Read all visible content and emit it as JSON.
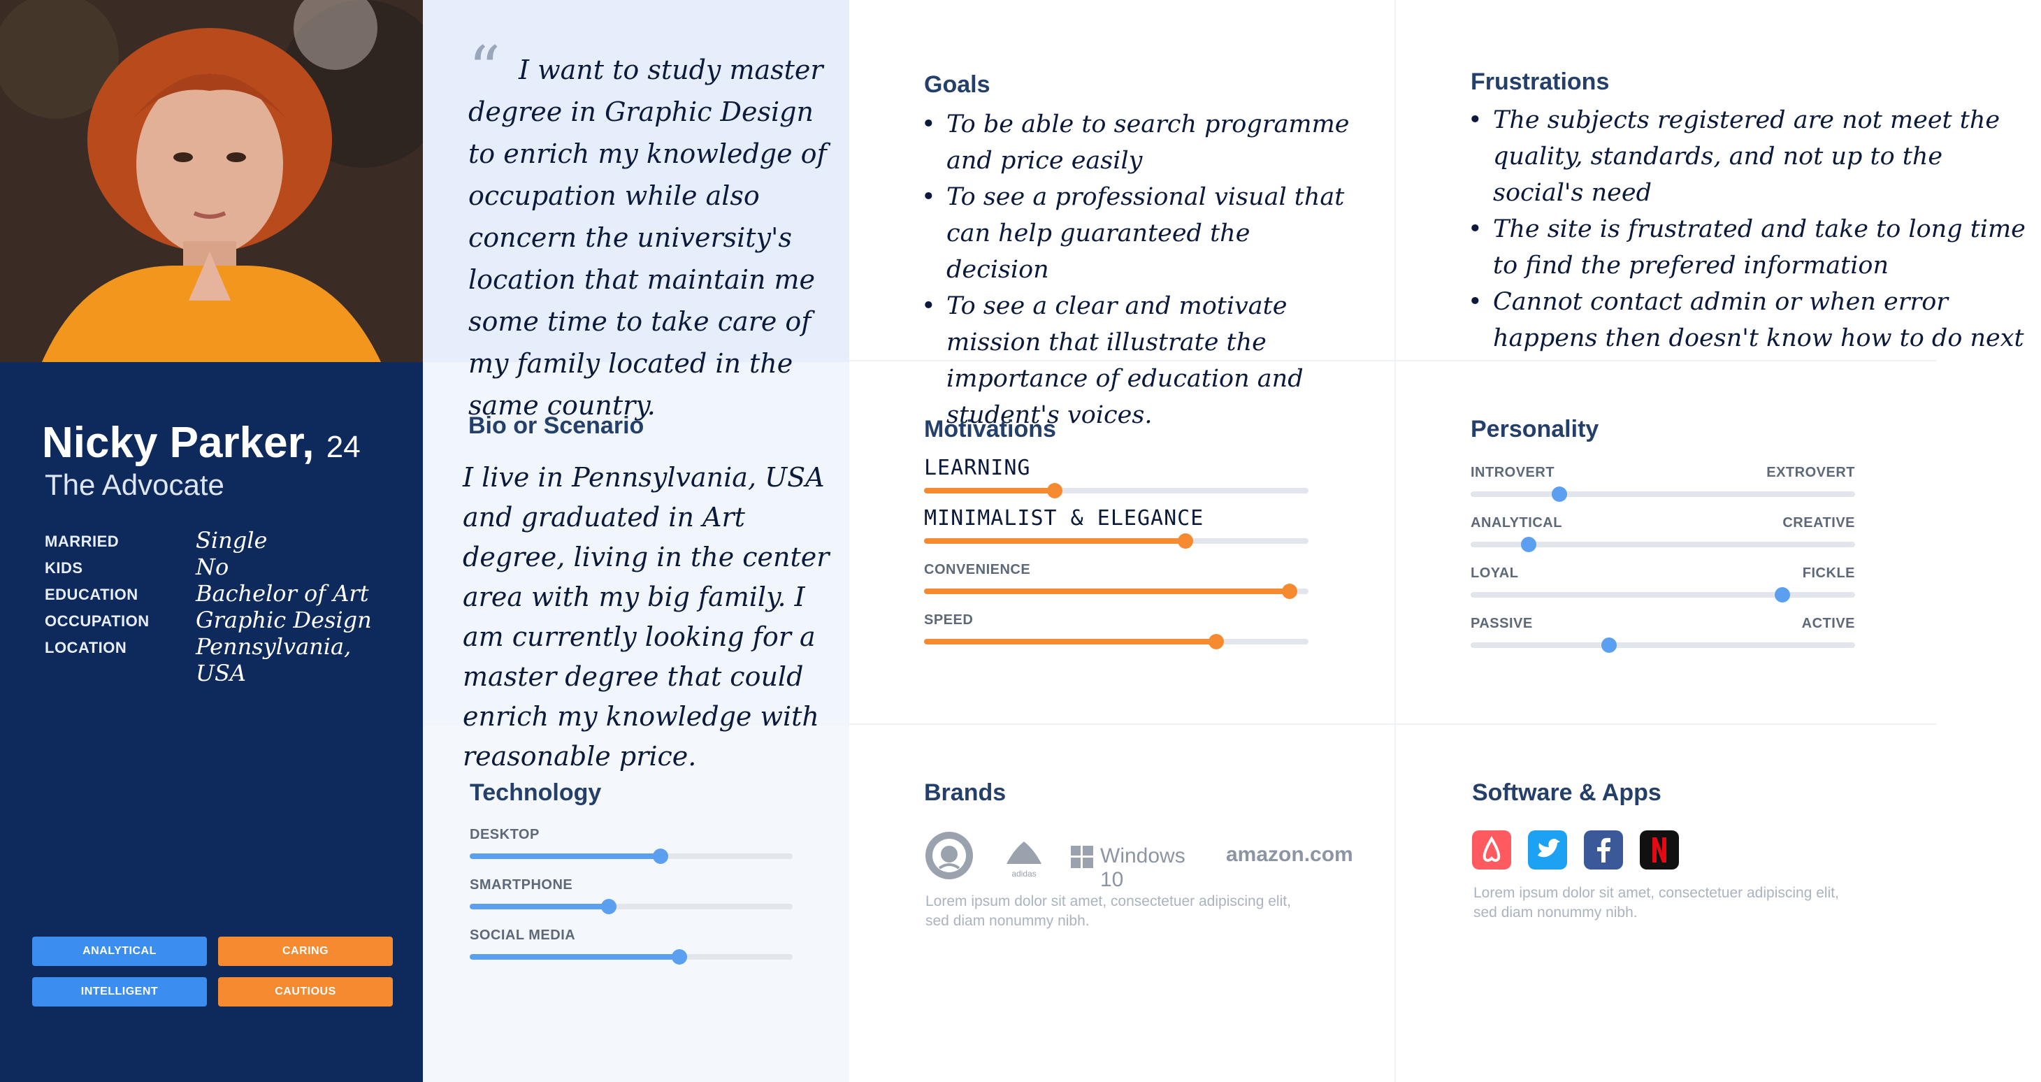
{
  "persona": {
    "name": "Nicky Parker,",
    "age": "24",
    "role": "The Advocate",
    "info": [
      {
        "label": "MARRIED",
        "value": "Single"
      },
      {
        "label": "KIDS",
        "value": "No"
      },
      {
        "label": "EDUCATION",
        "value": "Bachelor of Art"
      },
      {
        "label": "OCCUPATION",
        "value": "Graphic Design"
      },
      {
        "label": "LOCATION",
        "value": "Pennsylvania, USA"
      }
    ],
    "traits": [
      {
        "label": "ANALYTICAL",
        "color": "#3b8ef0"
      },
      {
        "label": "CARING",
        "color": "#f58a30"
      },
      {
        "label": "INTELLIGENT",
        "color": "#3b8ef0"
      },
      {
        "label": "CAUTIOUS",
        "color": "#f58a30"
      }
    ]
  },
  "quote": "I want to study master degree in Graphic Design to enrich my knowledge of occupation while also concern the university's location that maintain me some time to take care of my family located in the same country.",
  "goals": {
    "title": "Goals",
    "items": [
      "To be able to search programme and price easily",
      "To see a professional visual that can help guaranteed the decision",
      "To see a clear and motivate mission that illustrate the importance of education and student's voices."
    ]
  },
  "frustrations": {
    "title": "Frustrations",
    "items": [
      "The subjects registered are not meet the quality, standards, and not up to the social's need",
      "The site is frustrated and take to long time to find the prefered information",
      "Cannot contact admin or when error happens then doesn't know how to do next"
    ]
  },
  "bio": {
    "title": "Bio or Scenario",
    "text": "I live in Pennsylvania, USA and graduated in Art degree, living in the center area with my big family. I am currently looking for a master degree that could enrich my knowledge with reasonable price."
  },
  "motivations": {
    "title": "Motivations",
    "items": [
      {
        "label": "LEARNING",
        "value": 0.34
      },
      {
        "label": "MINIMALIST & ELEGANCE",
        "value": 0.68
      },
      {
        "label": "CONVENIENCE",
        "value": 0.95
      },
      {
        "label": "SPEED",
        "value": 0.76
      }
    ]
  },
  "personality": {
    "title": "Personality",
    "items": [
      {
        "left": "INTROVERT",
        "right": "EXTROVERT",
        "value": 0.23
      },
      {
        "left": "ANALYTICAL",
        "right": "CREATIVE",
        "value": 0.15
      },
      {
        "left": "LOYAL",
        "right": "FICKLE",
        "value": 0.81
      },
      {
        "left": "PASSIVE",
        "right": "ACTIVE",
        "value": 0.36
      }
    ]
  },
  "technology": {
    "title": "Technology",
    "items": [
      {
        "label": "DESKTOP",
        "value": 0.59
      },
      {
        "label": "SMARTPHONE",
        "value": 0.43
      },
      {
        "label": "SOCIAL MEDIA",
        "value": 0.65
      }
    ]
  },
  "brands": {
    "title": "Brands",
    "items": [
      "starbucks-logo",
      "adidas",
      "Windows 10",
      "amazon.com"
    ],
    "description": "Lorem ipsum dolor sit amet, consectetuer adipiscing elit, sed diam nonummy nibh."
  },
  "software": {
    "title": "Software & Apps",
    "apps": [
      {
        "icon": "airbnb-icon",
        "color": "#ff5a5f"
      },
      {
        "icon": "twitter-icon",
        "color": "#1da1f2"
      },
      {
        "icon": "facebook-icon",
        "color": "#3b5998"
      },
      {
        "icon": "netflix-icon",
        "color": "#e50914"
      }
    ],
    "description": "Lorem ipsum dolor sit amet, consectetuer adipiscing elit, sed diam nonummy nibh."
  },
  "colors": {
    "sidebar": "#0e2a5c",
    "orange": "#f58a30",
    "blue": "#5b9ff0"
  }
}
